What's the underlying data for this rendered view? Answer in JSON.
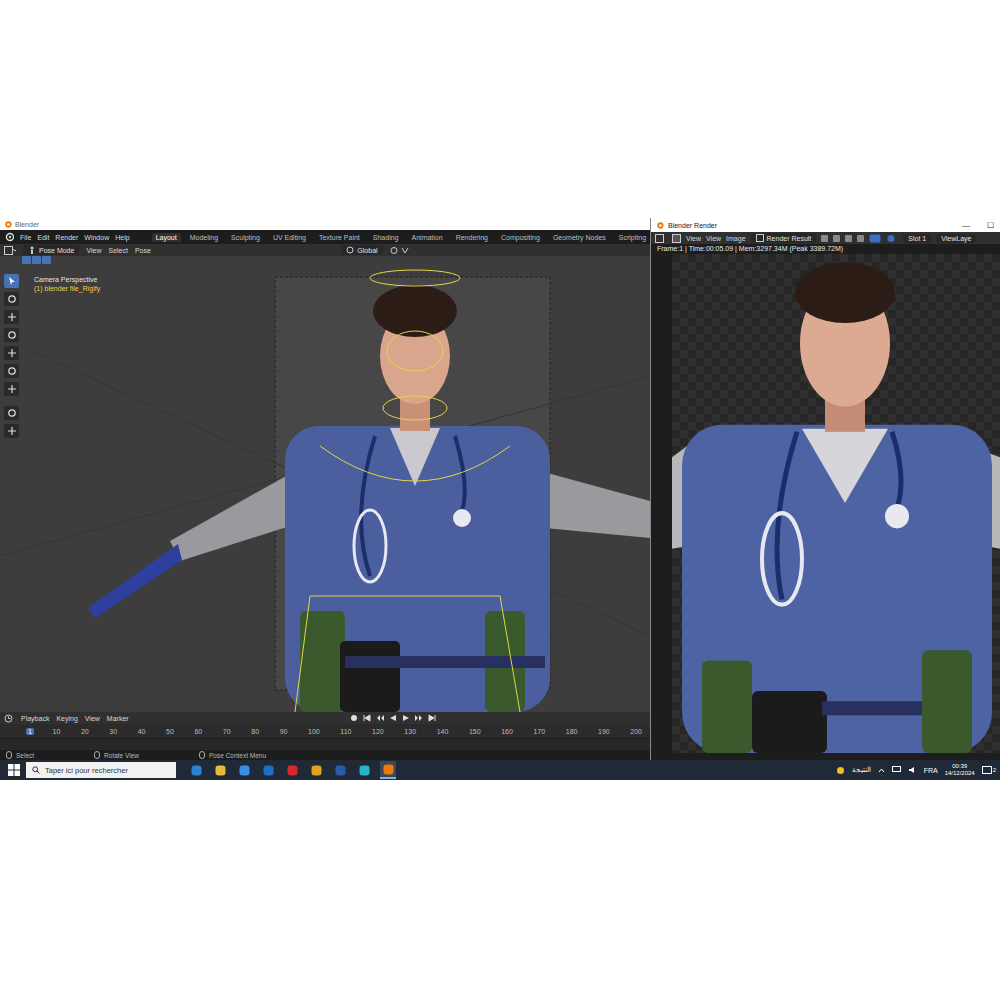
{
  "blender": {
    "title": "Blender",
    "menus": [
      "File",
      "Edit",
      "Render",
      "Window",
      "Help"
    ],
    "workspaces": [
      {
        "label": "Layout",
        "selected": true
      },
      {
        "label": "Modeling",
        "selected": false
      },
      {
        "label": "Sculpting",
        "selected": false
      },
      {
        "label": "UV Editing",
        "selected": false
      },
      {
        "label": "Texture Paint",
        "selected": false
      },
      {
        "label": "Shading",
        "selected": false
      },
      {
        "label": "Animation",
        "selected": false
      },
      {
        "label": "Rendering",
        "selected": false
      },
      {
        "label": "Compositing",
        "selected": false
      },
      {
        "label": "Geometry Nodes",
        "selected": false
      },
      {
        "label": "Scripting",
        "selected": false
      }
    ],
    "add_workspace": "+"
  },
  "header": {
    "mode": "Pose Mode",
    "menus": [
      "View",
      "Select",
      "Pose"
    ],
    "orientation": "Global"
  },
  "viewport": {
    "camera": "Camera Perspective",
    "object": "(1) blender file_Rigify"
  },
  "timeline": {
    "menus": [
      "Playback",
      "Keying",
      "View",
      "Marker"
    ],
    "frames": [
      {
        "label": "1",
        "selected": true
      },
      {
        "label": "10",
        "selected": false
      },
      {
        "label": "20",
        "selected": false
      },
      {
        "label": "30",
        "selected": false
      },
      {
        "label": "40",
        "selected": false
      },
      {
        "label": "50",
        "selected": false
      },
      {
        "label": "60",
        "selected": false
      },
      {
        "label": "70",
        "selected": false
      },
      {
        "label": "80",
        "selected": false
      },
      {
        "label": "90",
        "selected": false
      },
      {
        "label": "100",
        "selected": false
      },
      {
        "label": "110",
        "selected": false
      },
      {
        "label": "120",
        "selected": false
      },
      {
        "label": "130",
        "selected": false
      },
      {
        "label": "140",
        "selected": false
      },
      {
        "label": "150",
        "selected": false
      },
      {
        "label": "160",
        "selected": false
      },
      {
        "label": "170",
        "selected": false
      },
      {
        "label": "180",
        "selected": false
      },
      {
        "label": "190",
        "selected": false
      },
      {
        "label": "200",
        "selected": false
      }
    ]
  },
  "status_bar": [
    "Select",
    "Rotate View",
    "Pose Context Menu"
  ],
  "render_window": {
    "title": "Blender Render",
    "controls": [
      "—",
      "☐"
    ],
    "menus": [
      "View",
      "View",
      "Image"
    ],
    "image": "Render Result",
    "slot": "Slot 1",
    "view_layer": "ViewLaye",
    "info": "Frame:1 | Time:00:05.09 | Mem:3297.34M (Peak 3389.72M)"
  },
  "taskbar": {
    "search": "Taper ici pour rechercher",
    "weather": "النتيجة",
    "language": "FRA",
    "time": "00:39",
    "date": "14/12/2024",
    "notifications": "2"
  }
}
